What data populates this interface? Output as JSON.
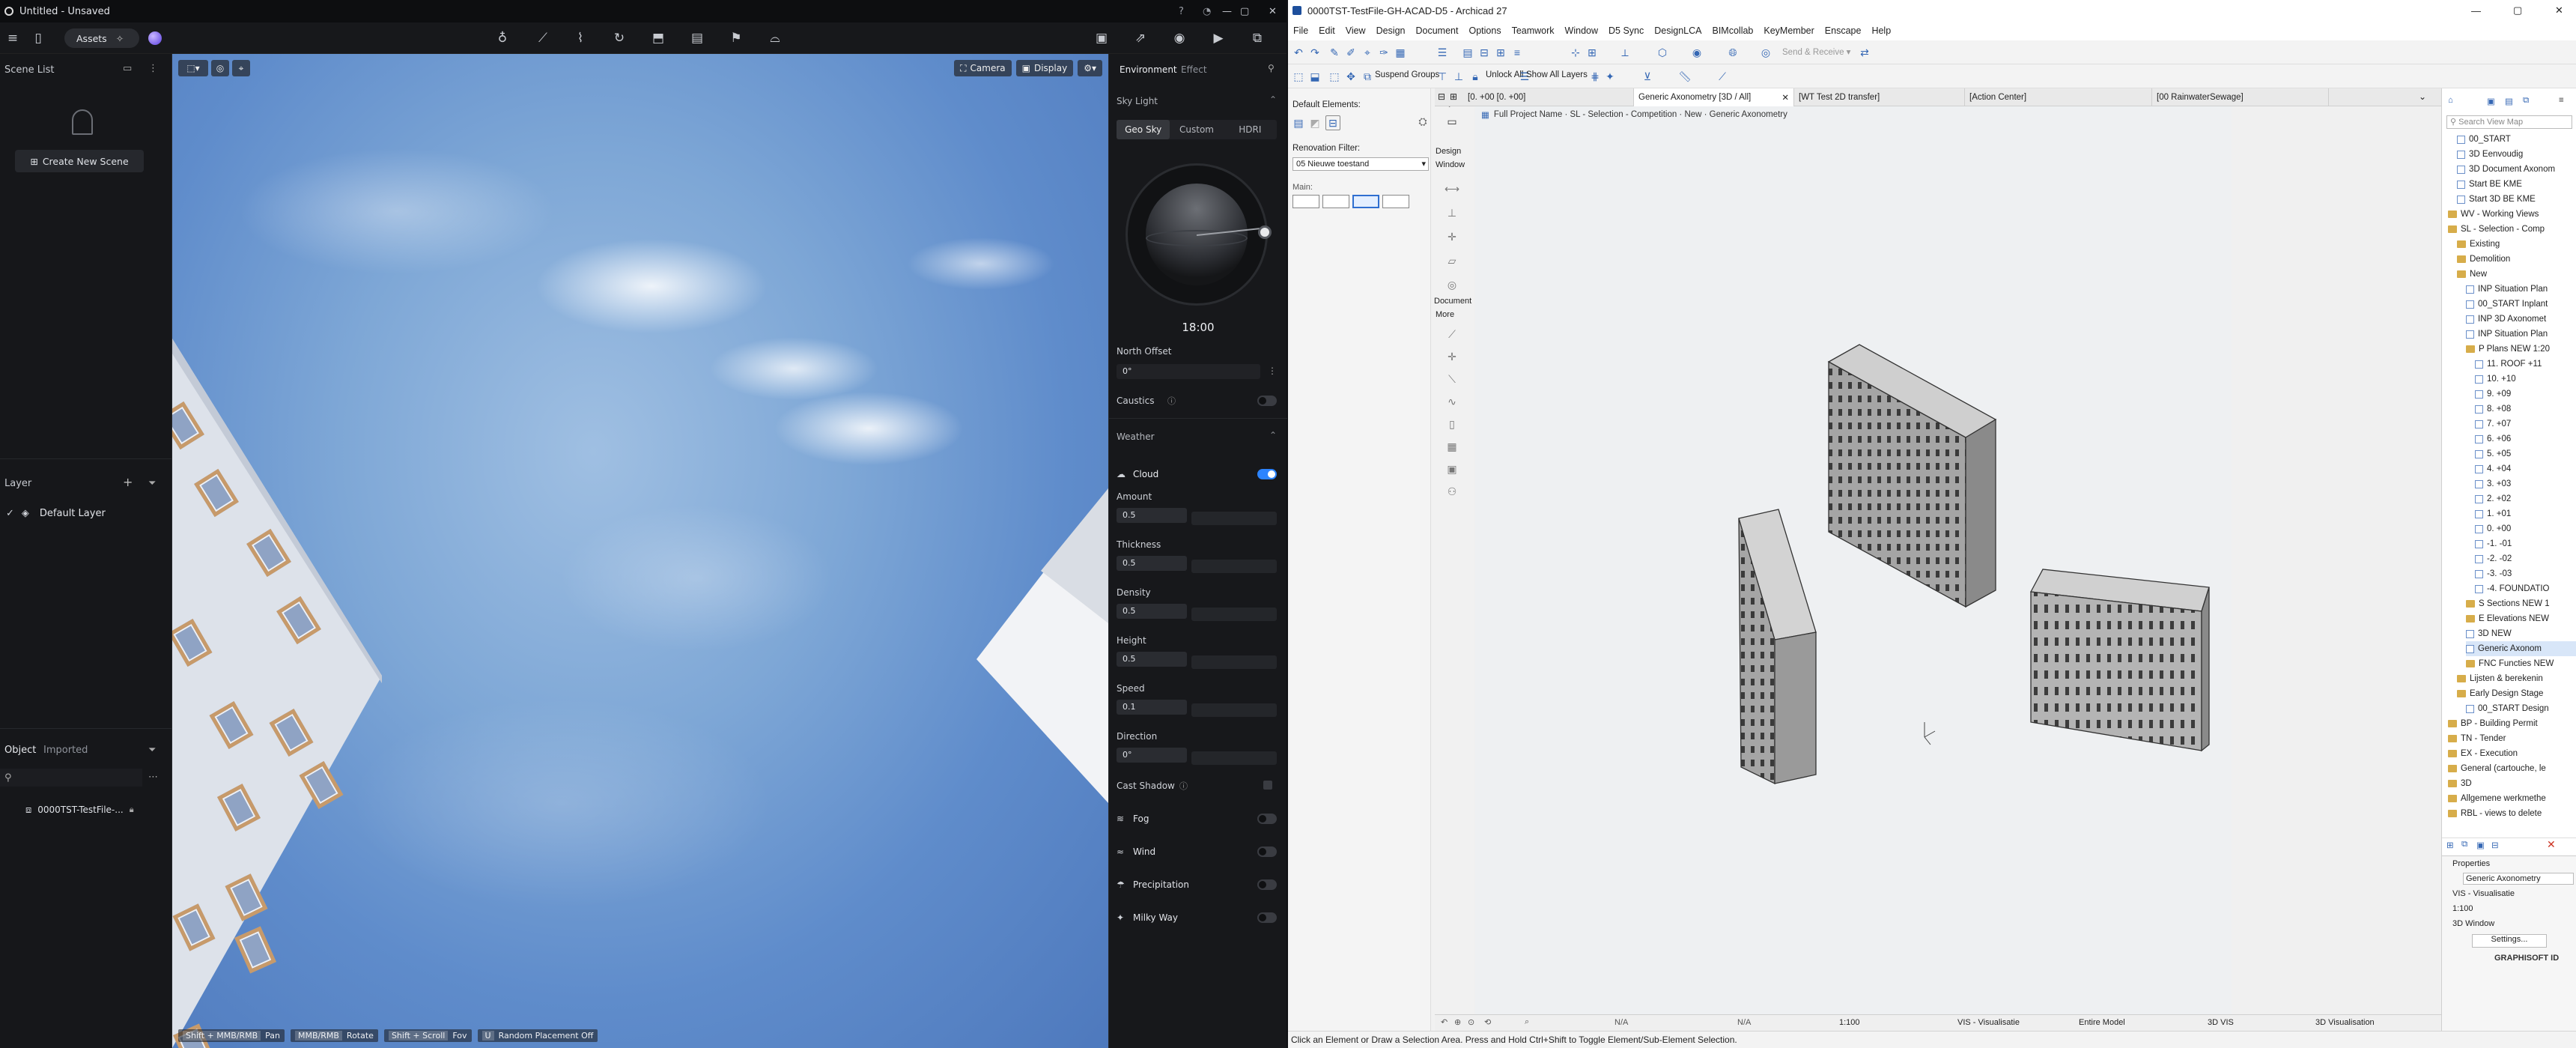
{
  "d5": {
    "title": "Untitled - Unsaved",
    "assets_label": "Assets",
    "scene_list": {
      "title": "Scene List",
      "create_label": "Create New Scene"
    },
    "layer": {
      "title": "Layer",
      "default_layer": "Default Layer"
    },
    "object_tabs": {
      "object": "Object",
      "imported": "Imported"
    },
    "object_item": "0000TST-TestFile-...",
    "viewport_buttons": {
      "camera": "Camera",
      "display": "Display"
    },
    "hints": [
      {
        "key": "Shift + MMB/RMB",
        "action": "Pan"
      },
      {
        "key": "MMB/RMB",
        "action": "Rotate"
      },
      {
        "key": "Shift + Scroll",
        "action": "Fov"
      },
      {
        "key": "U",
        "action": "Random Placement Off"
      }
    ],
    "right_panel": {
      "tabs": {
        "environment": "Environment",
        "effect": "Effect"
      },
      "sky_light": "Sky Light",
      "sky_modes": [
        "Geo Sky",
        "Custom",
        "HDRI"
      ],
      "time": "18:00",
      "north_offset_label": "North Offset",
      "north_offset_value": "0°",
      "caustics_label": "Caustics",
      "weather_label": "Weather",
      "cloud_label": "Cloud",
      "cloud_on": true,
      "sliders": [
        {
          "label": "Amount",
          "value": "0.5"
        },
        {
          "label": "Thickness",
          "value": "0.5"
        },
        {
          "label": "Density",
          "value": "0.5"
        },
        {
          "label": "Height",
          "value": "0.5"
        },
        {
          "label": "Speed",
          "value": "0.1"
        },
        {
          "label": "Direction",
          "value": "0°"
        }
      ],
      "cast_shadow_label": "Cast Shadow",
      "toggles": [
        {
          "label": "Fog",
          "on": false
        },
        {
          "label": "Wind",
          "on": false
        },
        {
          "label": "Precipitation",
          "on": false
        },
        {
          "label": "Milky Way",
          "on": false
        }
      ]
    }
  },
  "archicad": {
    "title": "0000TST-TestFile-GH-ACAD-D5 - Archicad 27",
    "menu": [
      "File",
      "Edit",
      "View",
      "Design",
      "Document",
      "Options",
      "Teamwork",
      "Window",
      "D5 Sync",
      "DesignLCA",
      "BIMcollab",
      "KeyMember",
      "Enscape",
      "Help"
    ],
    "toolbar": {
      "suspend_groups": "Suspend Groups",
      "unlock_all": "Unlock All",
      "show_all_layers": "Show All Layers",
      "send_receive": "Send & Receive"
    },
    "toolbox": {
      "default_elements": "Default Elements:",
      "renovation_filter_label": "Renovation Filter:",
      "renovation_filter_value": "05 Nieuwe toestand",
      "main_label": "Main:",
      "design_label": "Design",
      "window_label": "Window",
      "document_label": "Document",
      "more_label": "More"
    },
    "tabs": [
      {
        "label": "[0. +00 [0. +00]"
      },
      {
        "label": "Generic Axonometry [3D / All]"
      },
      {
        "label": "[WT Test 2D transfer]"
      },
      {
        "label": "[Action Center]"
      },
      {
        "label": "[00 RainwaterSewage]"
      }
    ],
    "breadcrumb": "Full Project Name · SL - Selection - Competition · New · Generic Axonometry",
    "view_bottom": {
      "scale": "1:100",
      "na1": "N/A",
      "na2": "N/A",
      "layer_combo": "VIS - Visualisatie",
      "model": "Entire Model",
      "vis3d": "3D VIS",
      "vis_name": "3D Visualisation"
    },
    "navigator": {
      "search_placeholder": "Search View Map",
      "items": [
        {
          "label": "00_START",
          "type": "view",
          "indent": 1
        },
        {
          "label": "3D Eenvoudig",
          "type": "view",
          "indent": 1
        },
        {
          "label": "3D Document Axonom",
          "type": "view",
          "indent": 1
        },
        {
          "label": "Start BE KME",
          "type": "view",
          "indent": 1
        },
        {
          "label": "Start 3D BE KME",
          "type": "view",
          "indent": 1
        },
        {
          "label": "WV - Working Views",
          "type": "folder",
          "indent": 0
        },
        {
          "label": "SL - Selection - Comp",
          "type": "folder",
          "indent": 0
        },
        {
          "label": "Existing",
          "type": "folder",
          "indent": 1
        },
        {
          "label": "Demolition",
          "type": "folder",
          "indent": 1
        },
        {
          "label": "New",
          "type": "folder",
          "indent": 1
        },
        {
          "label": "INP Situation Plan",
          "type": "view",
          "indent": 2
        },
        {
          "label": "00_START Inplant",
          "type": "view",
          "indent": 2
        },
        {
          "label": "INP 3D Axonomet",
          "type": "view",
          "indent": 2
        },
        {
          "label": "INP Situation Plan",
          "type": "view",
          "indent": 2
        },
        {
          "label": "P Plans NEW 1:20",
          "type": "folder",
          "indent": 2
        },
        {
          "label": "11. ROOF +11",
          "type": "view",
          "indent": 3
        },
        {
          "label": "10. +10",
          "type": "view",
          "indent": 3
        },
        {
          "label": "9. +09",
          "type": "view",
          "indent": 3
        },
        {
          "label": "8. +08",
          "type": "view",
          "indent": 3
        },
        {
          "label": "7. +07",
          "type": "view",
          "indent": 3
        },
        {
          "label": "6. +06",
          "type": "view",
          "indent": 3
        },
        {
          "label": "5. +05",
          "type": "view",
          "indent": 3
        },
        {
          "label": "4. +04",
          "type": "view",
          "indent": 3
        },
        {
          "label": "3. +03",
          "type": "view",
          "indent": 3
        },
        {
          "label": "2. +02",
          "type": "view",
          "indent": 3
        },
        {
          "label": "1. +01",
          "type": "view",
          "indent": 3
        },
        {
          "label": "0. +00",
          "type": "view",
          "indent": 3
        },
        {
          "label": "-1. -01",
          "type": "view",
          "indent": 3
        },
        {
          "label": "-2. -02",
          "type": "view",
          "indent": 3
        },
        {
          "label": "-3. -03",
          "type": "view",
          "indent": 3
        },
        {
          "label": "-4. FOUNDATIO",
          "type": "view",
          "indent": 3
        },
        {
          "label": "S Sections NEW 1",
          "type": "folder",
          "indent": 2
        },
        {
          "label": "E Elevations NEW",
          "type": "folder",
          "indent": 2
        },
        {
          "label": "3D NEW",
          "type": "view",
          "indent": 2
        },
        {
          "label": "Generic Axonom",
          "type": "view",
          "indent": 2,
          "selected": true
        },
        {
          "label": "FNC Functies NEW",
          "type": "folder",
          "indent": 2
        },
        {
          "label": "Lijsten & berekenin",
          "type": "folder",
          "indent": 1
        },
        {
          "label": "Early Design Stage",
          "type": "folder",
          "indent": 1
        },
        {
          "label": "00_START Design",
          "type": "view",
          "indent": 2
        },
        {
          "label": "BP - Building Permit",
          "type": "folder",
          "indent": 0
        },
        {
          "label": "TN - Tender",
          "type": "folder",
          "indent": 0
        },
        {
          "label": "EX - Execution",
          "type": "folder",
          "indent": 0
        },
        {
          "label": "General (cartouche, le",
          "type": "folder",
          "indent": 0
        },
        {
          "label": "3D",
          "type": "folder",
          "indent": 0
        },
        {
          "label": "Allgemene werkmethe",
          "type": "folder",
          "indent": 0
        },
        {
          "label": "RBL - views to delete",
          "type": "folder",
          "indent": 0
        }
      ],
      "properties_label": "Properties",
      "prop_name": "Generic Axonometry",
      "prop_layer": "VIS - Visualisatie",
      "prop_scale": "1:100",
      "prop_window": "3D Window",
      "settings_label": "Settings...",
      "brand": "GRAPHISOFT ID"
    },
    "status_text": "Click an Element or Draw a Selection Area. Press and Hold Ctrl+Shift to Toggle Element/Sub-Element Selection."
  }
}
